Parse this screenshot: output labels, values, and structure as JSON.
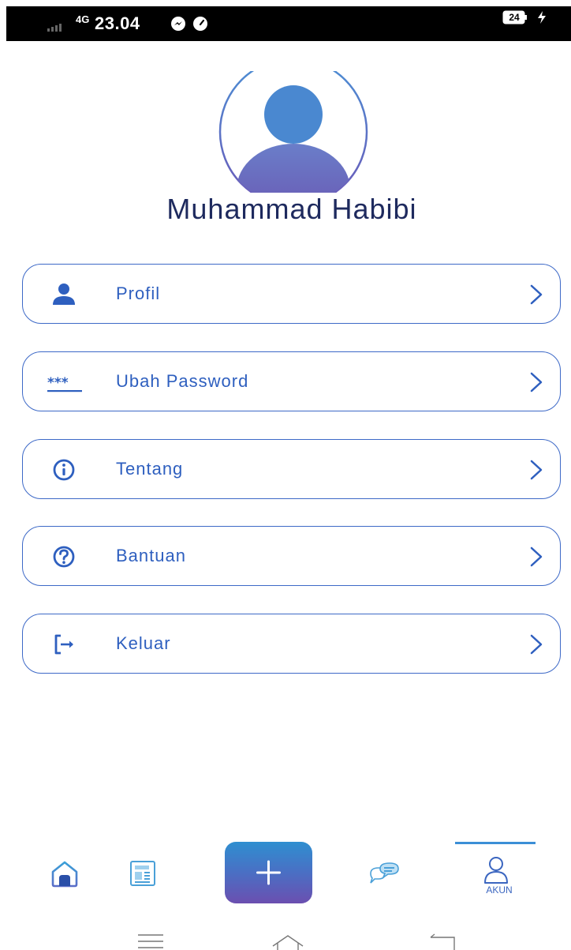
{
  "status_bar": {
    "network": "4G",
    "time": "23.04",
    "battery": "24"
  },
  "profile": {
    "name": "Muhammad Habibi"
  },
  "menu": [
    {
      "label": "Profil",
      "icon": "person-icon"
    },
    {
      "label": "Ubah Password",
      "icon": "password-icon"
    },
    {
      "label": "Tentang",
      "icon": "info-icon"
    },
    {
      "label": "Bantuan",
      "icon": "help-icon"
    },
    {
      "label": "Keluar",
      "icon": "logout-icon"
    }
  ],
  "bottom_nav": {
    "items": [
      {
        "name": "home",
        "icon": "home-icon"
      },
      {
        "name": "news",
        "icon": "newspaper-icon"
      },
      {
        "name": "add",
        "icon": "plus-icon"
      },
      {
        "name": "chat",
        "icon": "chat-icon"
      },
      {
        "name": "akun",
        "icon": "user-icon",
        "label": "AKUN",
        "active": true
      }
    ]
  },
  "colors": {
    "accent": "#2e5fbf",
    "border": "#3d69c7",
    "name_text": "#1e2a5e",
    "fab_top": "#2f8fd0",
    "fab_bottom": "#6b4fb0"
  }
}
